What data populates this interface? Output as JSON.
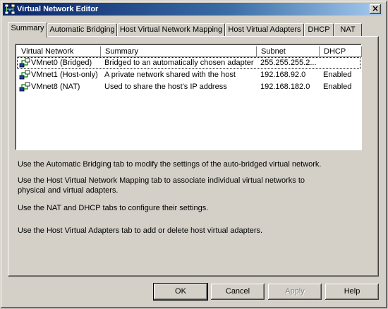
{
  "window": {
    "title": "Virtual Network Editor",
    "close_glyph": "×"
  },
  "tabs": [
    {
      "label": "Summary"
    },
    {
      "label": "Automatic Bridging"
    },
    {
      "label": "Host Virtual Network Mapping"
    },
    {
      "label": "Host Virtual Adapters"
    },
    {
      "label": "DHCP"
    },
    {
      "label": "NAT"
    }
  ],
  "table": {
    "columns": [
      "Virtual Network",
      "Summary",
      "Subnet",
      "DHCP"
    ],
    "rows": [
      {
        "network": "VMnet0 (Bridged)",
        "summary": "Bridged to an automatically chosen adapter",
        "subnet": "255.255.255.2...",
        "dhcp": "",
        "icon": "network-adapter-icon"
      },
      {
        "network": "VMnet1 (Host-only)",
        "summary": "A private network shared with the host",
        "subnet": "192.168.92.0",
        "dhcp": "Enabled",
        "icon": "network-adapter-icon"
      },
      {
        "network": "VMnet8 (NAT)",
        "summary": "Used to share the host's IP address",
        "subnet": "192.168.182.0",
        "dhcp": "Enabled",
        "icon": "network-adapter-icon"
      }
    ]
  },
  "descriptions": [
    {
      "text": "Use the Automatic Bridging tab to modify the settings of the auto-bridged virtual network."
    },
    {
      "line1": "Use the Host Virtual Network Mapping tab to associate individual virtual networks to",
      "line2": "physical and virtual adapters."
    },
    {
      "text": "Use the NAT and DHCP tabs to configure their settings."
    },
    {
      "text": "Use the Host Virtual Adapters tab to add or delete host virtual adapters."
    }
  ],
  "buttons": {
    "ok": "OK",
    "cancel": "Cancel",
    "apply": "Apply",
    "help": "Help"
  },
  "colors": {
    "titlebar_start": "#0a246a",
    "titlebar_end": "#a6caf0",
    "face": "#d4d0c8"
  }
}
